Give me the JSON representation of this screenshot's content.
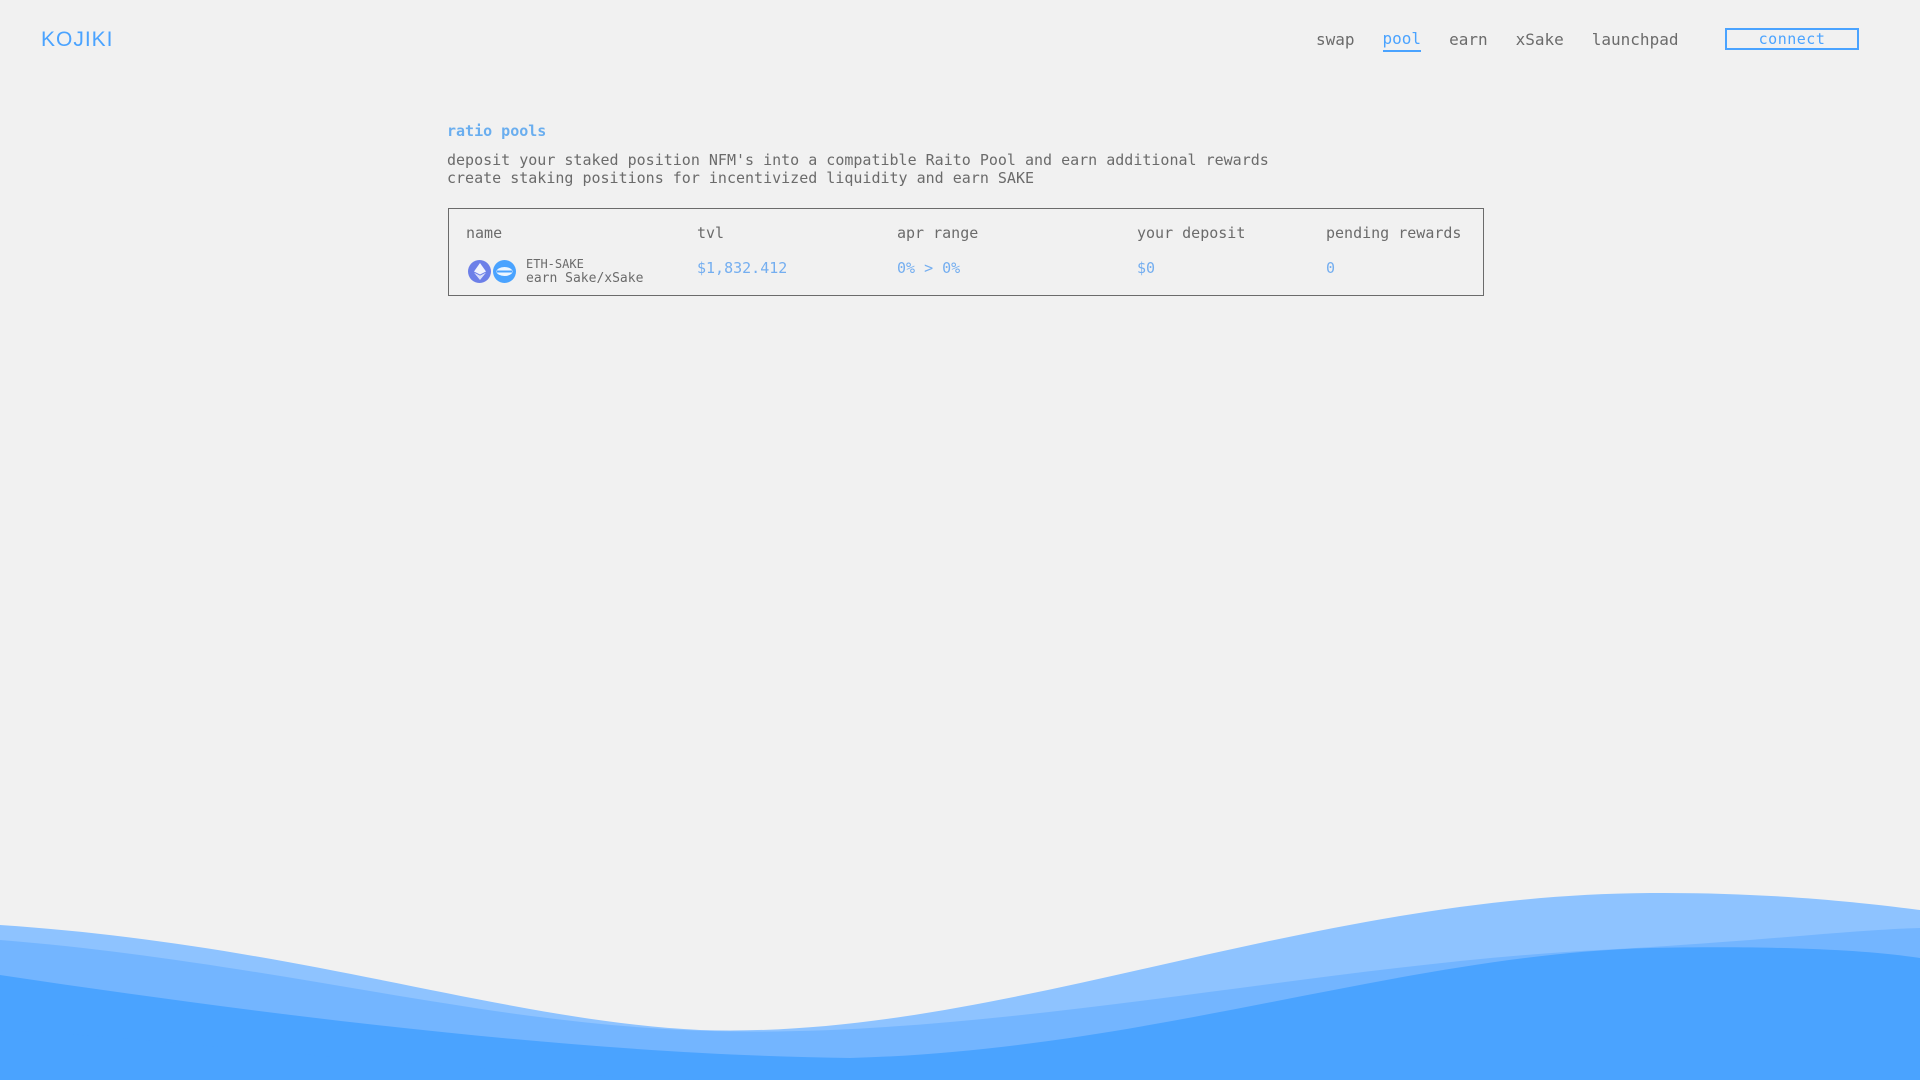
{
  "header": {
    "logo": "KOJIKI",
    "nav": [
      {
        "label": "swap",
        "active": false
      },
      {
        "label": "pool",
        "active": true
      },
      {
        "label": "earn",
        "active": false
      },
      {
        "label": "xSake",
        "active": false
      },
      {
        "label": "launchpad",
        "active": false
      }
    ],
    "connect_label": "connect"
  },
  "section": {
    "title": "ratio pools",
    "description_lines": [
      "deposit your staked position NFM's into a compatible Raito Pool and earn additional rewards",
      "create staking positions for incentivized liquidity and earn SAKE"
    ]
  },
  "table": {
    "columns": [
      "name",
      "tvl",
      "apr range",
      "your deposit",
      "pending rewards"
    ],
    "rows": [
      {
        "pair": "ETH-SAKE",
        "subtitle": "earn Sake/xSake",
        "tvl": "$1,832.412",
        "apr_range": "0% > 0%",
        "your_deposit": "$0",
        "pending_rewards": "0"
      }
    ]
  },
  "icons": {
    "token_a": "eth-icon",
    "token_b": "sake-icon"
  },
  "colors": {
    "accent": "#4aa3ff",
    "background": "#f1f1f1",
    "text": "#6b6b6b",
    "wave_light": "#8ec3ff",
    "wave_mid": "#6fb3ff",
    "wave_dark": "#4aa3ff"
  }
}
